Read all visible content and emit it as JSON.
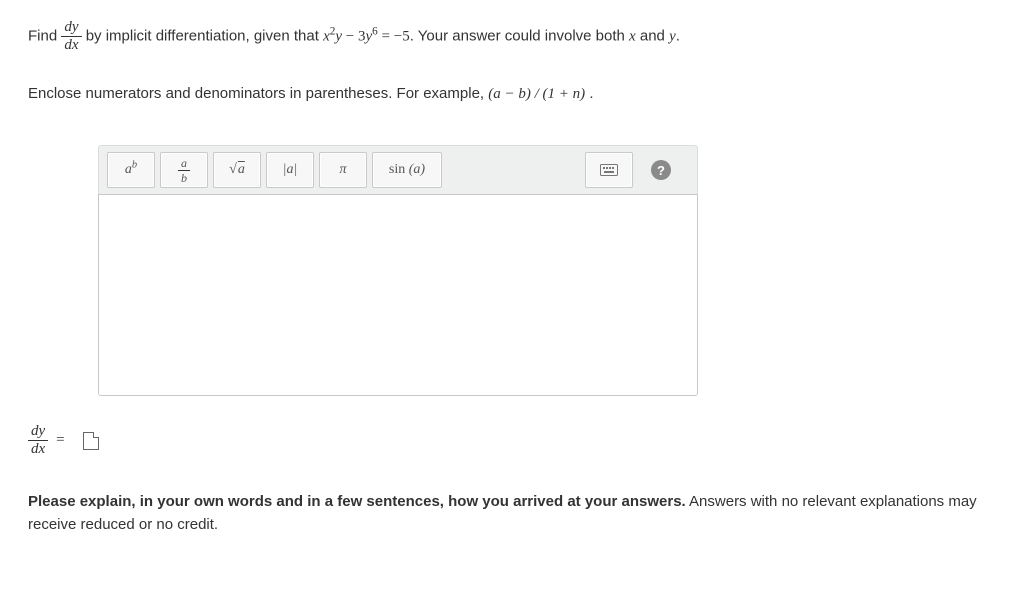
{
  "question": {
    "lead": "Find ",
    "frac_num": "dy",
    "frac_den": "dx",
    "after_frac": " by implicit differentiation, given that ",
    "equation_lhs_base1": "x",
    "equation_lhs_exp1": "2",
    "equation_lhs_y": "y",
    "equation_minus": " − 3",
    "equation_lhs_base2": "y",
    "equation_lhs_exp2": "6",
    "equation_eq": " = −5",
    "tail": ". Your answer could involve both ",
    "var_x": "x",
    "and": " and ",
    "var_y": "y",
    "period": "."
  },
  "instruction": {
    "text_a": "Enclose numerators and denominators in parentheses. For example, ",
    "example": "(a − b) / (1 + n)",
    "text_b": "."
  },
  "toolbar": {
    "power": {
      "base": "a",
      "exp": "b"
    },
    "frac": {
      "num": "a",
      "den": "b"
    },
    "sqrt": "a",
    "abs": "|a|",
    "pi": "π",
    "sin": "sin (a)",
    "help": "?"
  },
  "answer": {
    "frac_num": "dy",
    "frac_den": "dx",
    "equals": "="
  },
  "explain": {
    "bold": "Please explain, in your own words and in a few sentences, how you arrived at your answers.",
    "rest": " Answers with no relevant explanations may receive reduced or no credit."
  }
}
